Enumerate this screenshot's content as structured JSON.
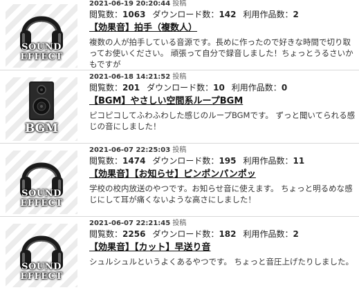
{
  "items": [
    {
      "thumb_type": "sound-effect",
      "thumb_line1": "SOUND",
      "thumb_line2": "EFFECT",
      "date": "2021-06-19 20:20:44",
      "posted_label": "投稿",
      "views_label": "閲覧数：",
      "views": "1063",
      "downloads_label": "ダウンロード数：",
      "downloads": "142",
      "uses_label": "利用作品数：",
      "uses": "2",
      "title": "【効果音】拍手（複数人）",
      "description": "複数の人が拍手している音源です。長めに作ったので好きな時間で切り取ってお使いください。 頑張って自分で録音しました！ちょっとうるさいかもですが"
    },
    {
      "thumb_type": "bgm",
      "thumb_line1": "BGM",
      "thumb_line2": "",
      "date": "2021-06-18 14:21:52",
      "posted_label": "投稿",
      "views_label": "閲覧数：",
      "views": "201",
      "downloads_label": "ダウンロード数：",
      "downloads": "10",
      "uses_label": "利用作品数：",
      "uses": "0",
      "title": "【BGM】やさしい空間系ループBGM",
      "description": "ピコピコしてふわふわした感じのループBGMです。 ずっと聞いてられる感じの音にしました！"
    },
    {
      "thumb_type": "sound-effect",
      "thumb_line1": "SOUND",
      "thumb_line2": "EFFECT",
      "date": "2021-06-07 22:25:03",
      "posted_label": "投稿",
      "views_label": "閲覧数：",
      "views": "1474",
      "downloads_label": "ダウンロード数：",
      "downloads": "195",
      "uses_label": "利用作品数：",
      "uses": "11",
      "title": "【効果音】【お知らせ】ピンポンパンポッ",
      "description": "学校の校内放送のやつです。お知らせ音に使えます。 ちょっと明るめな感じにして耳が痛くないような高さにしました！"
    },
    {
      "thumb_type": "sound-effect",
      "thumb_line1": "SOUND",
      "thumb_line2": "EFFECT",
      "date": "2021-06-07 22:21:45",
      "posted_label": "投稿",
      "views_label": "閲覧数：",
      "views": "2256",
      "downloads_label": "ダウンロード数：",
      "downloads": "182",
      "uses_label": "利用作品数：",
      "uses": "2",
      "title": "【効果音】【カット】早送り音",
      "description": "シュルシュルというよくあるやつです。 ちょっと音圧上げたりしました。"
    }
  ]
}
